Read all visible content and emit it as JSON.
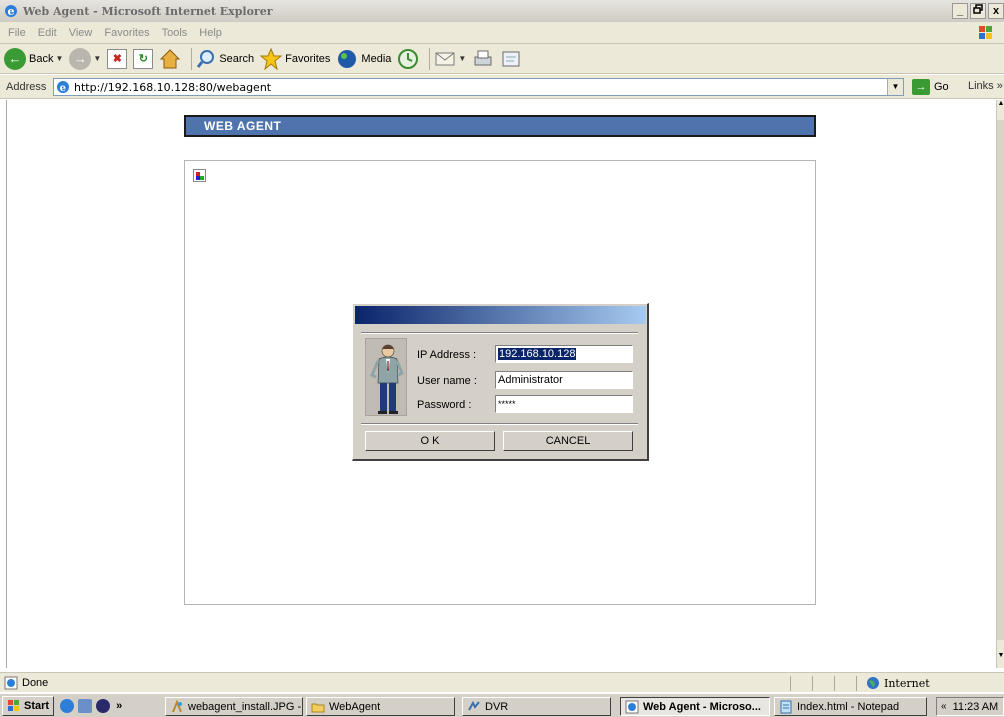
{
  "window": {
    "title": "Web Agent - Microsoft Internet Explorer",
    "controls": [
      "_",
      " ",
      "x"
    ]
  },
  "menubar": {
    "items": [
      "File",
      "Edit",
      "View",
      "Favorites",
      "Tools",
      "Help"
    ]
  },
  "toolbar": {
    "back_label": "Back",
    "search_label": "Search",
    "favorites_label": "Favorites",
    "media_label": "Media"
  },
  "addressbar": {
    "label": "Address",
    "url": "http://192.168.10.128:80/webagent",
    "go_label": "Go",
    "links_label": "Links"
  },
  "page": {
    "banner": "WEB AGENT"
  },
  "login": {
    "ip_label": "IP Address :",
    "ip_value": "192.168.10.128",
    "user_label": "User name :",
    "user_value": "Administrator",
    "password_label": "Password :",
    "password_value": "*****",
    "ok_label": "O K",
    "cancel_label": "CANCEL"
  },
  "statusbar": {
    "status": "Done",
    "zone": "Internet"
  },
  "taskbar": {
    "start_label": "Start",
    "more": "»",
    "tasks": [
      {
        "label": "webagent_install.JPG - ...",
        "icon": "paint-icon"
      },
      {
        "label": "WebAgent",
        "icon": "folder-icon"
      },
      {
        "label": "DVR",
        "icon": "dvr-icon"
      },
      {
        "label": "Web Agent - Microso...",
        "icon": "ie-icon",
        "active": true
      },
      {
        "label": "Index.html - Notepad",
        "icon": "notepad-icon"
      }
    ],
    "tray_chevron": "«",
    "clock": "11:23 AM"
  }
}
